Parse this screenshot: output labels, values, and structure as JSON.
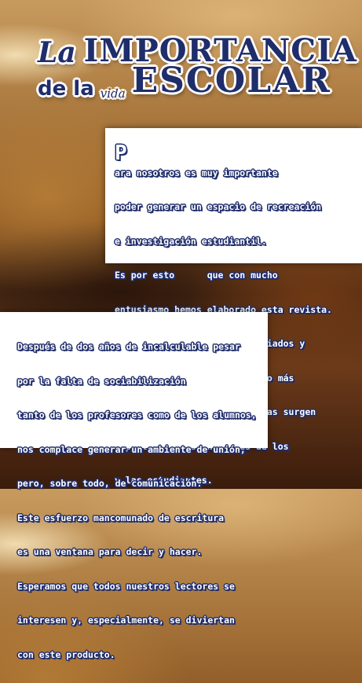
{
  "title": {
    "line1_a": "La",
    "line1_b": "IMPORTANCIA",
    "line2_a": "de la",
    "line2_b": "vida",
    "line2_c": "ESCOLAR"
  },
  "colors": {
    "accent": "#1f2d6b",
    "box": "#ffffff"
  },
  "intro": {
    "drop_cap": "P",
    "lines": [
      "ara nosotros es muy importante",
      "poder generar un espacio de recreación",
      "e investigación estudiantil.",
      "Es por esto      que con mucho",
      "entusiasmo hemos elaborado esta revista.",
      "Los temas que aborda son variados y",
      "entretenidos, no obstante, lo más",
      "relevante es que las temáticas surgen",
      "a partir de los intereses de los",
      "y las estudiantes."
    ]
  },
  "second": {
    "lines": [
      "Después de dos años de incalculable pesar",
      "por la falta de sociabilización",
      "tanto de los profesores como de los alumnos,",
      "nos complace generar un ambiente de unión,",
      "pero, sobre todo, de comunicación.",
      "Este esfuerzo mancomunado de escritura",
      "es una ventana para decir y hacer.",
      "Esperamos que todos nuestros lectores se",
      "interesen y, especialmente, se diviertan",
      "con este producto."
    ]
  }
}
